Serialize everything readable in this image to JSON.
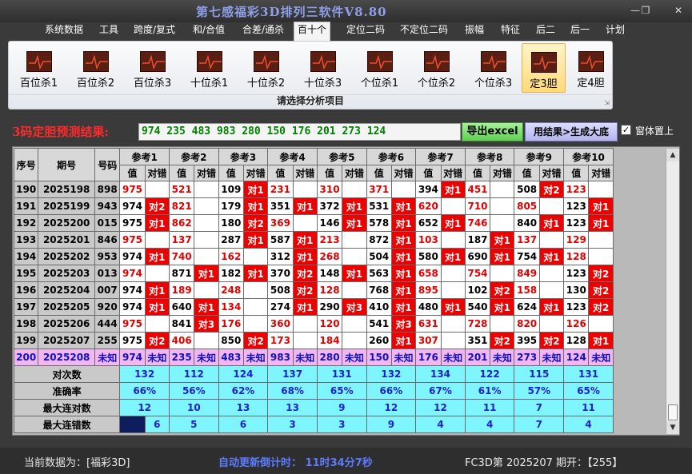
{
  "app": {
    "title": "第七感福彩3D排列三软件V8.80"
  },
  "menu": [
    "系统数据",
    "工具",
    "跨度/复式",
    "和/合值",
    "合差/通杀",
    "百十个",
    "定位二码",
    "不定位二码",
    "振幅",
    "特征",
    "后二",
    "后一",
    "计划"
  ],
  "active_menu": "百十个",
  "ribbon": {
    "buttons": [
      "百位杀1",
      "百位杀2",
      "百位杀3",
      "十位杀1",
      "十位杀2",
      "十位杀3",
      "个位杀1",
      "个位杀2",
      "个位杀3",
      "定3胆",
      "定4胆"
    ],
    "selected": "定3胆",
    "caption": "请选择分析项目"
  },
  "result": {
    "label": "3码定胆预测结果:",
    "value": "974  235  483  983  280  150  176  201  273  124",
    "export_button": "导出excel",
    "generate_button": "用结果>生成大底",
    "checkbox_checked": true,
    "checkbox_label": "窗体置上"
  },
  "grid": {
    "headers": {
      "id": "序号",
      "issue": "期号",
      "code": "号码",
      "value": "值",
      "hit": "对错"
    },
    "refs": [
      "参考1",
      "参考2",
      "参考3",
      "参考4",
      "参考5",
      "参考6",
      "参考7",
      "参考8",
      "参考9",
      "参考10"
    ],
    "rows": [
      {
        "id": "190",
        "issue": "2025198",
        "code": "898",
        "cells": [
          [
            "975",
            ""
          ],
          [
            "521",
            ""
          ],
          [
            "109",
            "对1"
          ],
          [
            "231",
            ""
          ],
          [
            "310",
            ""
          ],
          [
            "371",
            ""
          ],
          [
            "394",
            "对1"
          ],
          [
            "451",
            ""
          ],
          [
            "508",
            "对2"
          ],
          [
            "123",
            ""
          ]
        ]
      },
      {
        "id": "191",
        "issue": "2025199",
        "code": "943",
        "cells": [
          [
            "974",
            "对2"
          ],
          [
            "821",
            ""
          ],
          [
            "179",
            "对1"
          ],
          [
            "351",
            "对1"
          ],
          [
            "372",
            "对1"
          ],
          [
            "531",
            "对1"
          ],
          [
            "620",
            ""
          ],
          [
            "710",
            ""
          ],
          [
            "805",
            ""
          ],
          [
            "123",
            "对1"
          ]
        ]
      },
      {
        "id": "192",
        "issue": "2025200",
        "code": "015",
        "cells": [
          [
            "975",
            "对1"
          ],
          [
            "862",
            ""
          ],
          [
            "180",
            "对2"
          ],
          [
            "369",
            ""
          ],
          [
            "146",
            "对1"
          ],
          [
            "578",
            "对1"
          ],
          [
            "652",
            "对1"
          ],
          [
            "746",
            ""
          ],
          [
            "840",
            "对1"
          ],
          [
            "123",
            "对1"
          ]
        ]
      },
      {
        "id": "193",
        "issue": "2025201",
        "code": "846",
        "cells": [
          [
            "975",
            ""
          ],
          [
            "137",
            ""
          ],
          [
            "287",
            "对1"
          ],
          [
            "587",
            "对1"
          ],
          [
            "213",
            ""
          ],
          [
            "872",
            "对1"
          ],
          [
            "103",
            ""
          ],
          [
            "187",
            "对1"
          ],
          [
            "137",
            ""
          ],
          [
            "129",
            ""
          ]
        ]
      },
      {
        "id": "194",
        "issue": "2025202",
        "code": "953",
        "cells": [
          [
            "974",
            "对1"
          ],
          [
            "740",
            ""
          ],
          [
            "162",
            ""
          ],
          [
            "312",
            "对1"
          ],
          [
            "268",
            ""
          ],
          [
            "504",
            "对1"
          ],
          [
            "580",
            "对1"
          ],
          [
            "690",
            "对1"
          ],
          [
            "754",
            "对1"
          ],
          [
            "128",
            ""
          ]
        ]
      },
      {
        "id": "195",
        "issue": "2025203",
        "code": "013",
        "cells": [
          [
            "974",
            ""
          ],
          [
            "871",
            "对1"
          ],
          [
            "182",
            "对1"
          ],
          [
            "370",
            "对2"
          ],
          [
            "148",
            "对1"
          ],
          [
            "563",
            "对1"
          ],
          [
            "658",
            ""
          ],
          [
            "754",
            ""
          ],
          [
            "849",
            ""
          ],
          [
            "123",
            "对2"
          ]
        ]
      },
      {
        "id": "196",
        "issue": "2025204",
        "code": "007",
        "cells": [
          [
            "974",
            "对1"
          ],
          [
            "189",
            ""
          ],
          [
            "248",
            ""
          ],
          [
            "508",
            "对2"
          ],
          [
            "128",
            ""
          ],
          [
            "768",
            "对1"
          ],
          [
            "895",
            ""
          ],
          [
            "102",
            "对2"
          ],
          [
            "158",
            ""
          ],
          [
            "130",
            "对2"
          ]
        ]
      },
      {
        "id": "197",
        "issue": "2025205",
        "code": "920",
        "cells": [
          [
            "974",
            "对1"
          ],
          [
            "640",
            "对1"
          ],
          [
            "134",
            ""
          ],
          [
            "274",
            "对1"
          ],
          [
            "290",
            "对3"
          ],
          [
            "410",
            "对1"
          ],
          [
            "480",
            "对1"
          ],
          [
            "540",
            "对1"
          ],
          [
            "624",
            "对1"
          ],
          [
            "123",
            "对2"
          ]
        ]
      },
      {
        "id": "198",
        "issue": "2025206",
        "code": "444",
        "cells": [
          [
            "975",
            ""
          ],
          [
            "841",
            "对3"
          ],
          [
            "176",
            ""
          ],
          [
            "360",
            ""
          ],
          [
            "120",
            ""
          ],
          [
            "541",
            "对3"
          ],
          [
            "631",
            ""
          ],
          [
            "728",
            ""
          ],
          [
            "820",
            ""
          ],
          [
            "126",
            ""
          ]
        ]
      },
      {
        "id": "199",
        "issue": "2025207",
        "code": "255",
        "cells": [
          [
            "975",
            "对2"
          ],
          [
            "406",
            ""
          ],
          [
            "850",
            "对2"
          ],
          [
            "173",
            ""
          ],
          [
            "184",
            ""
          ],
          [
            "260",
            "对1"
          ],
          [
            "307",
            ""
          ],
          [
            "351",
            "对2"
          ],
          [
            "395",
            "对2"
          ],
          [
            "128",
            "对1"
          ]
        ]
      }
    ],
    "pending": {
      "id": "200",
      "issue": "2025208",
      "code": "未知",
      "cells": [
        [
          "974",
          "未知"
        ],
        [
          "235",
          "未知"
        ],
        [
          "483",
          "未知"
        ],
        [
          "983",
          "未知"
        ],
        [
          "280",
          "未知"
        ],
        [
          "150",
          "未知"
        ],
        [
          "176",
          "未知"
        ],
        [
          "201",
          "未知"
        ],
        [
          "273",
          "未知"
        ],
        [
          "124",
          "未知"
        ]
      ]
    },
    "stats": [
      {
        "label": "对次数",
        "values": [
          "132",
          "112",
          "124",
          "137",
          "131",
          "132",
          "134",
          "122",
          "115",
          "131"
        ]
      },
      {
        "label": "准确率",
        "values": [
          "66%",
          "56%",
          "62%",
          "68%",
          "65%",
          "66%",
          "67%",
          "61%",
          "57%",
          "65%"
        ]
      },
      {
        "label": "最大连对数",
        "values": [
          "12",
          "10",
          "13",
          "13",
          "9",
          "12",
          "12",
          "11",
          "7",
          "11"
        ]
      },
      {
        "label": "最大连错数",
        "values": [
          "6",
          "5",
          "6",
          "3",
          "3",
          "9",
          "4",
          "4",
          "7",
          "4"
        ]
      }
    ]
  },
  "status": {
    "current": "当前数据为：[福彩3D]",
    "countdown": "自动更新倒计时：  11时34分7秒",
    "period": "FC3D第 2025207 期开：【255】"
  },
  "colors": {
    "hit": "#ee0000",
    "miss_value": "#e00000",
    "stat_bg": "#7ff5ff",
    "stat_text": "#2020cc",
    "pending_bg": "#f2b6f2",
    "result_text": "#008000",
    "title": "#8e9fe8"
  }
}
